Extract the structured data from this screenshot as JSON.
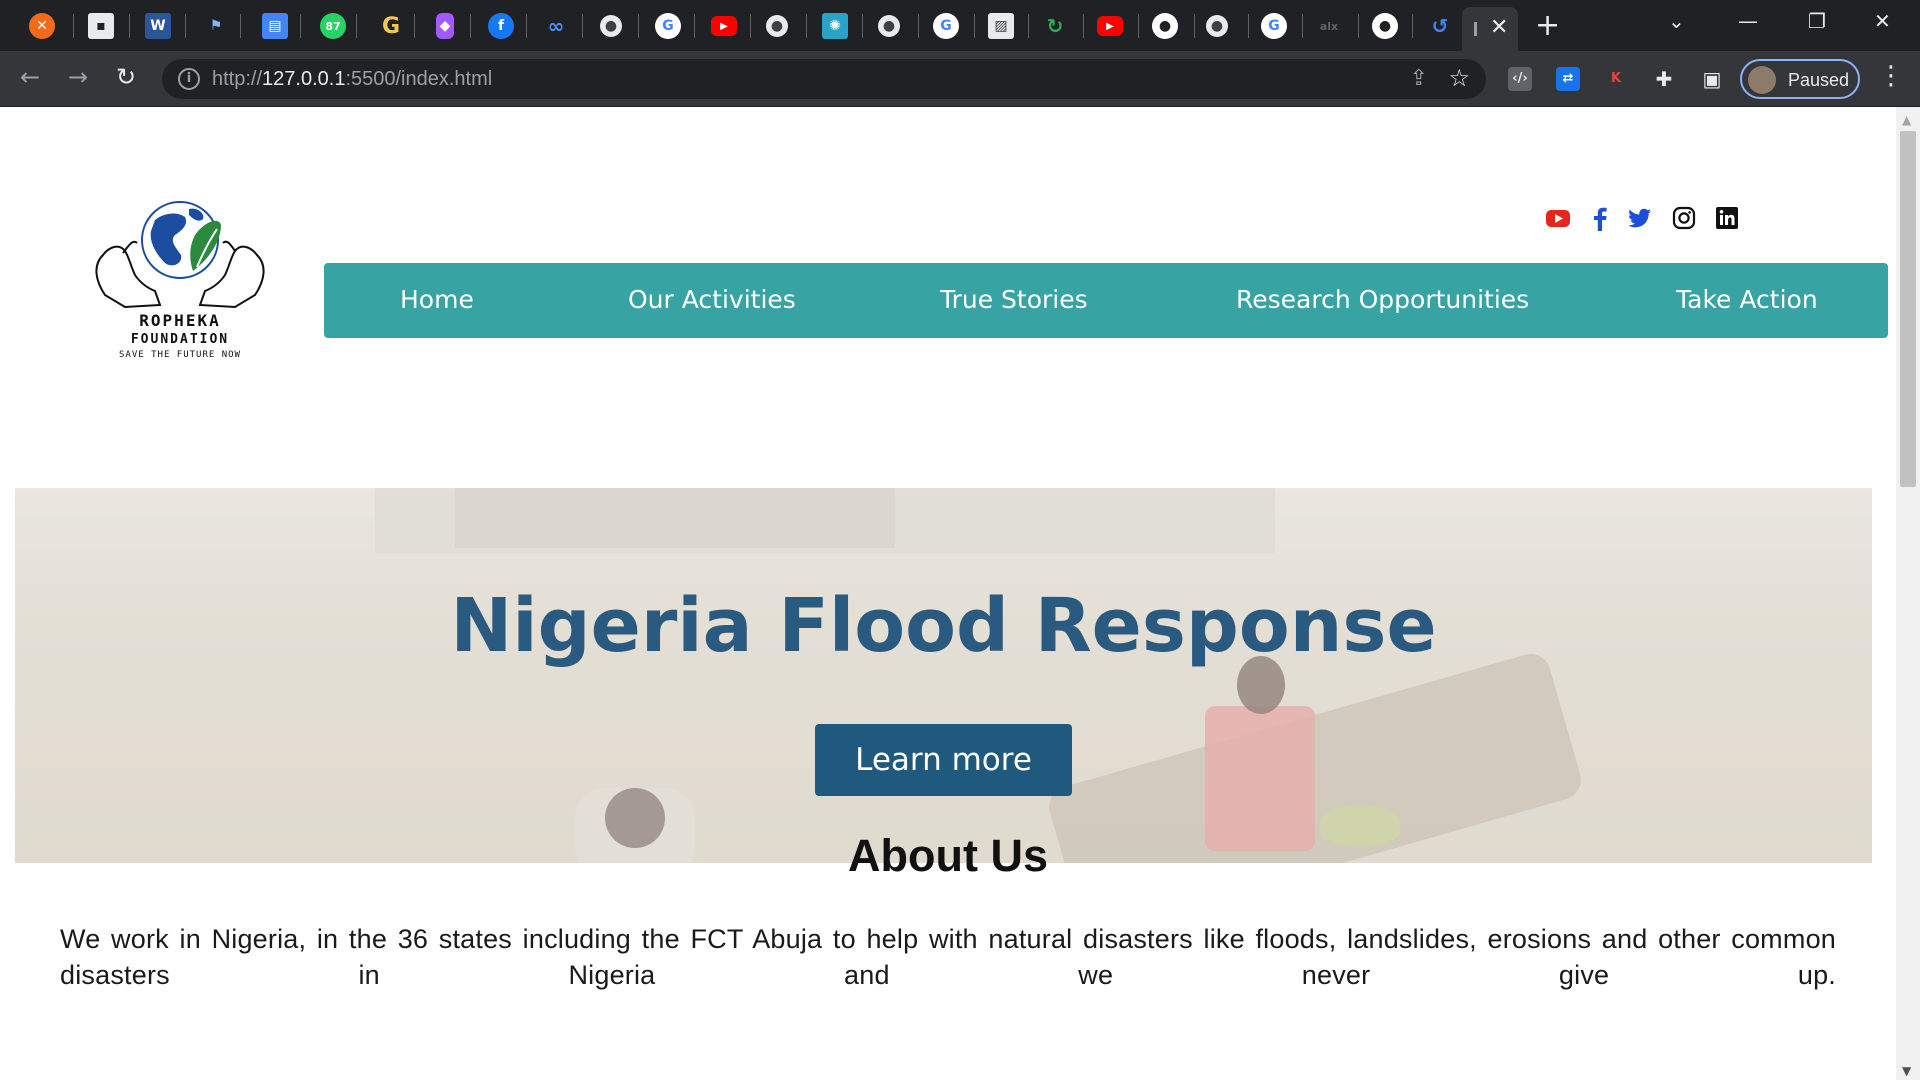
{
  "browser": {
    "address": {
      "scheme": "http://",
      "host": "127.0.0.1",
      "rest": ":5500/index.html"
    },
    "profile_label": "Paused",
    "tab_icons": [
      "xampp-icon",
      "notion-icon",
      "word-icon",
      "flag-icon",
      "docs-icon",
      "whatsapp-icon",
      "grammarly-icon",
      "figma-icon",
      "facebook-icon",
      "meta-icon",
      "globe-icon",
      "google-icon",
      "youtube-icon",
      "globe-icon",
      "gear-icon",
      "globe-icon",
      "google-icon",
      "image-icon",
      "app-icon",
      "youtube-icon",
      "github-icon",
      "globe-icon",
      "google-icon",
      "alx-icon",
      "github-icon",
      "loop-icon"
    ]
  },
  "site": {
    "logo": {
      "name": "ROPHEKA",
      "sub": "FOUNDATION",
      "tagline": "SAVE THE FUTURE NOW"
    },
    "social": [
      "youtube-icon",
      "facebook-icon",
      "twitter-icon",
      "instagram-icon",
      "linkedin-icon"
    ],
    "nav": [
      {
        "label": "Home"
      },
      {
        "label": "Our Activities"
      },
      {
        "label": "True Stories"
      },
      {
        "label": "Research Opportunities"
      },
      {
        "label": "Take Action"
      }
    ],
    "hero": {
      "title": "Nigeria Flood Response",
      "button": "Learn more"
    },
    "about": {
      "title": "About Us",
      "text": "We work in Nigeria, in the 36 states including the FCT Abuja to help with natural disasters like floods, landslides, erosions and other common disasters in Nigeria and we never give up."
    }
  },
  "colors": {
    "nav_bg": "#37a3a3",
    "hero_title": "#2a5a80",
    "button_bg": "#1f5a7e",
    "chrome_dark": "#202124"
  }
}
